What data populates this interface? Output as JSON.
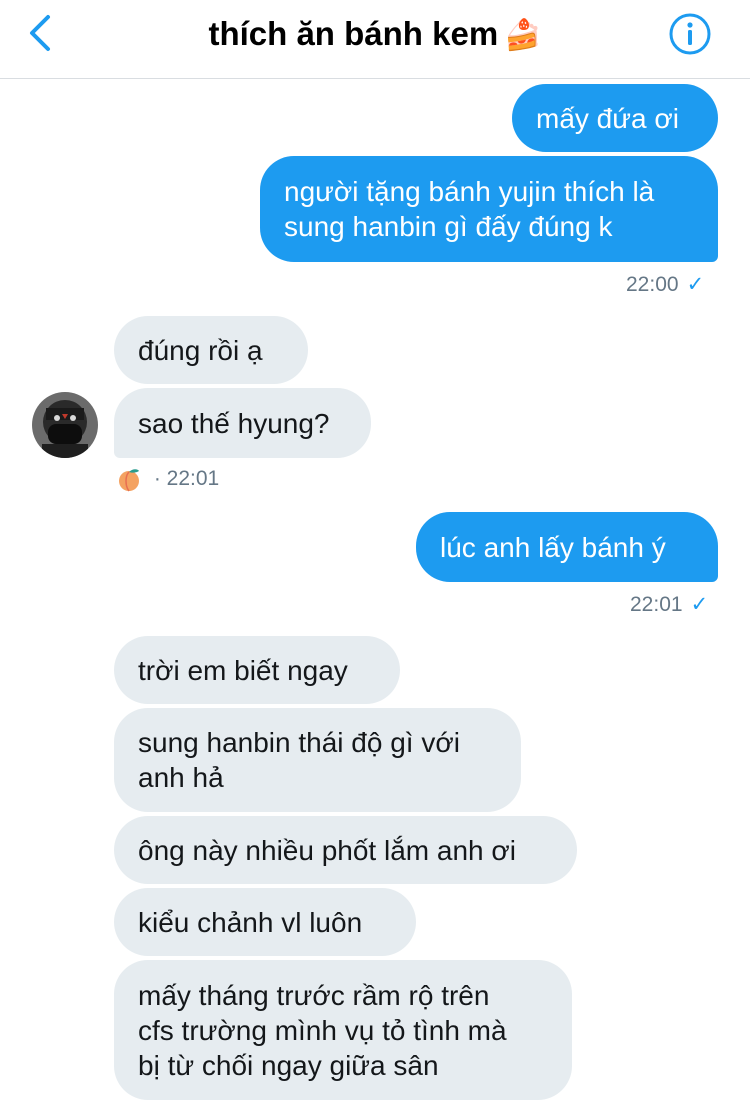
{
  "header": {
    "title": "thích ăn bánh kem",
    "title_emoji": "🍰",
    "back_icon": "chevron-left-icon",
    "info_icon": "info-circle-icon"
  },
  "colors": {
    "accent": "#1d9bf0",
    "incoming_bubble": "#e6ecf0",
    "meta_text": "#657786"
  },
  "messages": [
    {
      "dir": "out",
      "lines": [
        "mấy đứa ơi"
      ]
    },
    {
      "dir": "out",
      "lines": [
        "người tặng bánh yujin thích là",
        "sung hanbin gì đấy đúng k"
      ]
    },
    {
      "dir": "in",
      "lines": [
        "đúng rồi ạ"
      ]
    },
    {
      "dir": "in",
      "lines": [
        "sao thế hyung?"
      ]
    },
    {
      "dir": "out",
      "lines": [
        "lúc anh lấy bánh ý"
      ]
    },
    {
      "dir": "in",
      "lines": [
        "trời em biết ngay"
      ]
    },
    {
      "dir": "in",
      "lines": [
        "sung hanbin thái độ gì với",
        "anh hả"
      ]
    },
    {
      "dir": "in",
      "lines": [
        "ông này nhiều phốt lắm anh ơi"
      ]
    },
    {
      "dir": "in",
      "lines": [
        "kiểu chảnh vl luôn"
      ]
    },
    {
      "dir": "in",
      "lines": [
        "mấy tháng trước rầm rộ trên",
        "cfs trường mình vụ tỏ tình mà",
        "bị từ chối ngay giữa sân"
      ]
    }
  ],
  "meta": {
    "time1": "22:00",
    "time2": "· 22:01",
    "time3": "22:01",
    "check": "✓",
    "reaction_icon": "peach-emoji-icon"
  }
}
